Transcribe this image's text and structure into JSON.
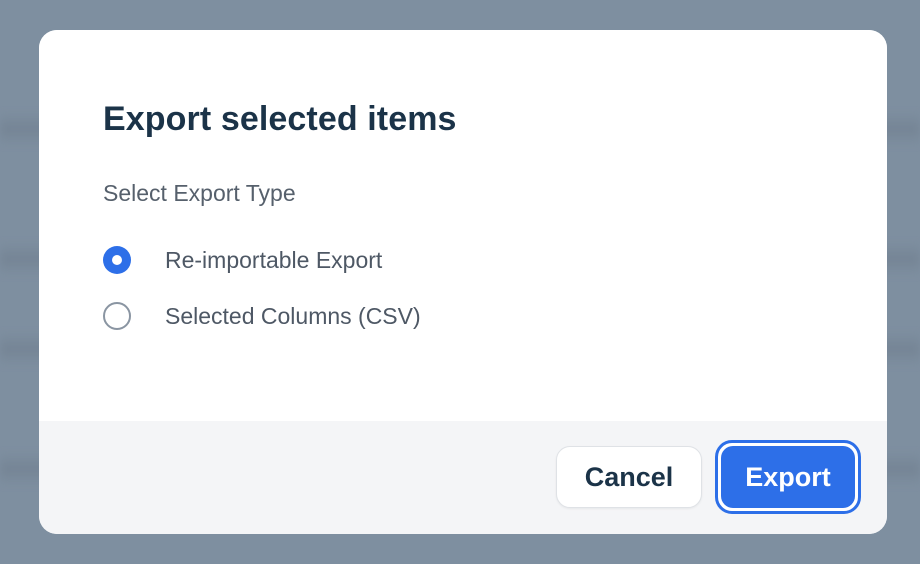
{
  "dialog": {
    "title": "Export selected items",
    "section_label": "Select Export Type",
    "options": [
      {
        "label": "Re-importable Export",
        "checked": true
      },
      {
        "label": "Selected Columns (CSV)",
        "checked": false
      }
    ],
    "cancel_label": "Cancel",
    "export_label": "Export"
  },
  "colors": {
    "accent": "#2d6fe8",
    "title": "#1b3348",
    "backdrop": "#7e8fa0",
    "footer": "#f4f5f7"
  }
}
